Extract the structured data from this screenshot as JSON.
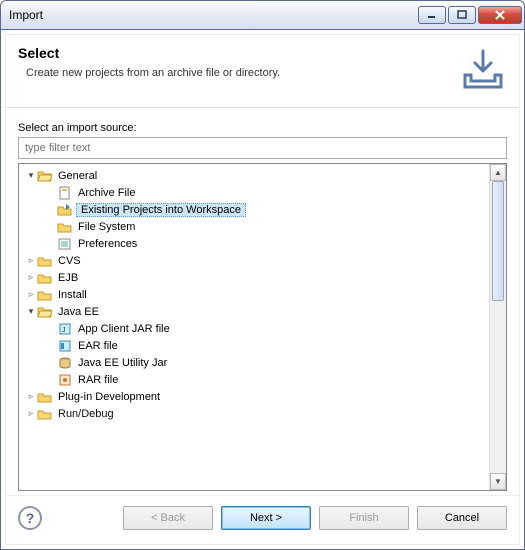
{
  "titlebar": {
    "title": "Import"
  },
  "header": {
    "heading": "Select",
    "subheading": "Create new projects from an archive file or directory."
  },
  "content": {
    "label": "Select an import source:",
    "filter_placeholder": "type filter text"
  },
  "tree": {
    "general": {
      "label": "General",
      "children": [
        {
          "id": "archive-file",
          "label": "Archive File"
        },
        {
          "id": "existing-projects",
          "label": "Existing Projects into Workspace",
          "selected": true
        },
        {
          "id": "file-system",
          "label": "File System"
        },
        {
          "id": "preferences",
          "label": "Preferences"
        }
      ]
    },
    "cvs": {
      "label": "CVS"
    },
    "ejb": {
      "label": "EJB"
    },
    "install": {
      "label": "Install"
    },
    "javaee": {
      "label": "Java EE",
      "children": [
        {
          "id": "app-client-jar",
          "label": "App Client JAR file"
        },
        {
          "id": "ear-file",
          "label": "EAR file"
        },
        {
          "id": "javaee-utility-jar",
          "label": "Java EE Utility Jar"
        },
        {
          "id": "rar-file",
          "label": "RAR file"
        }
      ]
    },
    "plugin_dev": {
      "label": "Plug-in Development"
    },
    "run_debug": {
      "label": "Run/Debug"
    }
  },
  "buttons": {
    "back": "< Back",
    "next": "Next >",
    "finish": "Finish",
    "cancel": "Cancel"
  }
}
